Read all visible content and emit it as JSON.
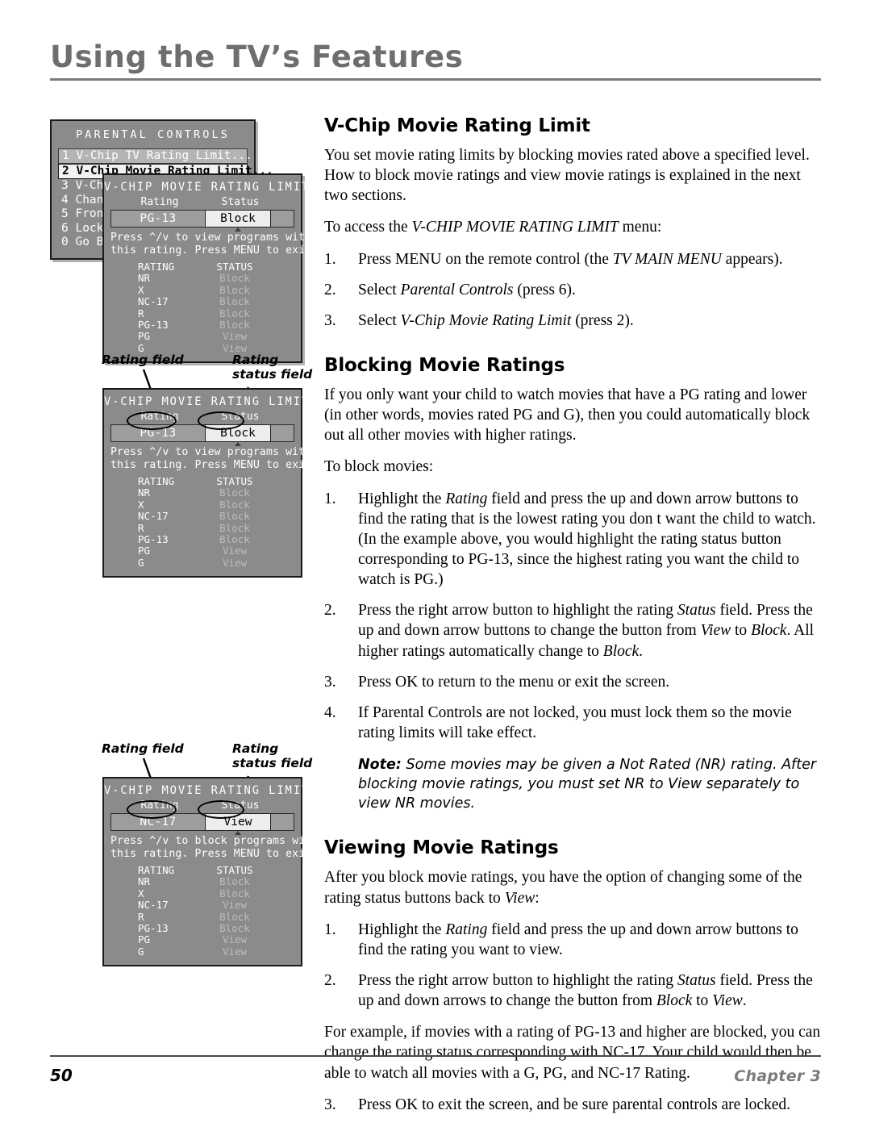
{
  "header": {
    "title": "Using the TV’s Features"
  },
  "footer": {
    "page_number": "50",
    "chapter": "Chapter 3"
  },
  "content": {
    "section1": {
      "title": "V-Chip Movie Rating Limit",
      "para1": "You set movie rating limits by blocking movies rated above a specified level. How to block movie ratings and view movie ratings is explained in the next two sections.",
      "para2_prefix": "To access the ",
      "para2_italic": "V-CHIP MOVIE RATING LIMIT",
      "para2_suffix": " menu:",
      "steps": [
        {
          "num": "1.",
          "pre": "Press MENU on the remote control (the ",
          "it": "TV MAIN MENU",
          "post": " appears)."
        },
        {
          "num": "2.",
          "pre": "Select ",
          "it": "Parental Controls",
          "post": " (press 6)."
        },
        {
          "num": "3.",
          "pre": "Select ",
          "it": "V-Chip Movie Rating Limit",
          "post": " (press 2)."
        }
      ]
    },
    "section2": {
      "title": "Blocking Movie Ratings",
      "para1": "If you only want your child to watch movies that have a PG rating and lower (in other words, movies rated PG and G), then you could automatically block out all other movies with higher ratings.",
      "para2": "To block movies:",
      "step1": {
        "num": "1.",
        "pre": "Highlight the ",
        "it": "Rating",
        "post": " field and press the up and down arrow buttons to find the rating that is the lowest rating you don t want the child to watch.  (In the example above, you would highlight the rating status button corresponding to PG-13, since the highest rating you want the child to watch is PG.)"
      },
      "step2": {
        "num": "2.",
        "a": "Press the right arrow button to highlight the rating ",
        "it1": "Status",
        "b": " field. Press the up and down arrow buttons to change the button from ",
        "it2": "View",
        "c": " to ",
        "it3": "Block",
        "d": ". All higher ratings automatically change to ",
        "it4": "Block",
        "e": "."
      },
      "step3": {
        "num": "3.",
        "text": "Press OK to return to the menu or exit the screen."
      },
      "step4": {
        "num": "4.",
        "text": "If Parental Controls are not locked, you must lock them so the movie rating limits will take effect."
      },
      "note_lead": "Note:",
      "note_text": " Some movies may be given a Not Rated (NR) rating. After blocking movie ratings, you must set NR to View separately to view NR movies."
    },
    "section3": {
      "title": "Viewing Movie Ratings",
      "para1_pre": "After you block movie ratings, you have the option of changing some of the rating status buttons back to ",
      "para1_it": "View",
      "para1_post": ":",
      "step1": {
        "num": "1.",
        "pre": "Highlight the ",
        "it": "Rating",
        "post": " field and press the up and down arrow buttons to find the rating you want to view."
      },
      "step2": {
        "num": "2.",
        "a": "Press the right arrow button to highlight the rating ",
        "it1": "Status",
        "b": " field. Press the up and down arrows to change the button from ",
        "it2": "Block",
        "c": "  to ",
        "it3": "View",
        "d": "."
      },
      "para2": "For example, if movies with a rating of PG-13 and higher are blocked, you can change the rating status corresponding with NC-17. Your child would then be able to watch all movies with a G, PG, and NC-17 Rating.",
      "step3": {
        "num": "3.",
        "text": "Press OK to exit the screen, and be sure parental controls are locked."
      }
    }
  },
  "graphics": {
    "parental_controls": {
      "heading": "PARENTAL CONTROLS",
      "items": [
        {
          "label": "1 V-Chip TV Rating Limit...",
          "state": "highlight-light"
        },
        {
          "label": "2 V-Chip Movie Rating Limit...",
          "state": "highlight-selected"
        },
        {
          "label": "3 V-Ch",
          "state": "normal"
        },
        {
          "label": "4 Chan",
          "state": "normal"
        },
        {
          "label": "5 Fron",
          "state": "normal"
        },
        {
          "label": "6 Lock",
          "state": "normal"
        },
        {
          "label": "0 Go B",
          "state": "normal"
        }
      ]
    },
    "vchip_common": {
      "title": "V-CHIP MOVIE RATING LIMIT",
      "col_rating": "Rating",
      "col_status": "Status",
      "table_hdr_rating": "RATING",
      "table_hdr_status": "STATUS",
      "ratings": [
        "NR",
        "X",
        "NC-17",
        "R",
        "PG-13",
        "PG",
        "G"
      ]
    },
    "vchip_overlay": {
      "field_rating": "PG-13",
      "field_status": "Block",
      "help_line1": "Press ^/v to view programs with",
      "help_line2": "this rating. Press MENU to exit.",
      "statuses": [
        "Block",
        "Block",
        "Block",
        "Block",
        "Block",
        "View",
        "View"
      ]
    },
    "vchip_second": {
      "field_rating": "PG-13",
      "field_status": "Block",
      "help_line1": "Press ^/v to view programs with",
      "help_line2": "this rating. Press MENU to exit.",
      "statuses": [
        "Block",
        "Block",
        "Block",
        "Block",
        "Block",
        "View",
        "View"
      ],
      "callout_rating": "Rating field",
      "callout_status": "Rating\nstatus field"
    },
    "vchip_third": {
      "field_rating": "NC-17",
      "field_status": "View",
      "help_line1": "Press ^/v to block programs with",
      "help_line2": "this rating. Press MENU to exit.",
      "statuses": [
        "Block",
        "Block",
        "View",
        "Block",
        "Block",
        "View",
        "View"
      ],
      "callout_rating": "Rating field",
      "callout_status": "Rating\nstatus field"
    }
  },
  "colors": {
    "osd_background": "#8b8b8b",
    "osd_text": "#ffffff",
    "osd_status_dim": "#bdbdbd",
    "title_gray": "#6e6e6e",
    "chapter_gray": "#7b7b7b"
  }
}
